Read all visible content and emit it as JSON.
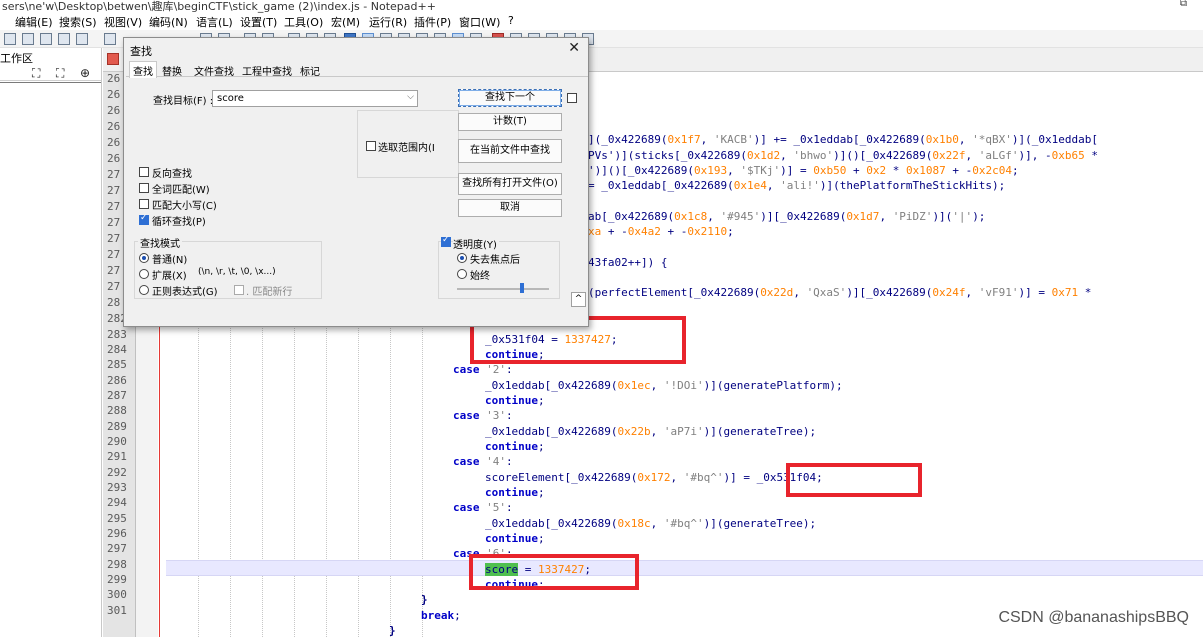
{
  "window": {
    "title": "sers\\ne'w\\Desktop\\betwen\\趣库\\beginCTF\\stick_game (2)\\index.js - Notepad++",
    "restore_glyph": "⧉"
  },
  "menu": [
    "编辑(E)",
    "搜索(S)",
    "视图(V)",
    "编码(N)",
    "语言(L)",
    "设置(T)",
    "工具(O)",
    "宏(M)",
    "运行(R)",
    "插件(P)",
    "窗口(W)",
    "?"
  ],
  "workspace": {
    "title": "工作区",
    "icons": [
      "sync-icon",
      "sync-scroll-icon",
      "locate-icon"
    ]
  },
  "editor": {
    "line_numbers_top": [
      "26",
      "26",
      "26",
      "26",
      "26",
      "26",
      "27",
      "27",
      "27",
      "27",
      "27",
      "27",
      "27",
      "27",
      "28"
    ],
    "line_numbers": [
      "282",
      "283",
      "284",
      "285",
      "286",
      "287",
      "288",
      "289",
      "290",
      "291",
      "292",
      "293",
      "294",
      "295",
      "296",
      "297",
      "298",
      "299",
      "300",
      "301"
    ],
    "right_code": [
      {
        "t1": "](_0x422689(",
        "h1": "0x1f7",
        "t2": ", ",
        "s1": "'KACB'",
        "t3": ")] += _0x1eddab[_0x422689(",
        "h2": "0x1b0",
        "t4": ", ",
        "s2": "'*qBX'",
        "t5": ")](_0x1eddab["
      },
      {
        "t1": "PVs')](sticks[_0x422689(",
        "h1": "0x1d2",
        "t2": ", ",
        "s1": "'bhwo'",
        "t3": ")]()[_0x422689(",
        "h2": "0x22f",
        "t4": ", ",
        "s2": "'aLGf'",
        "t5": ")], -",
        "h3": "0xb65",
        "t6": " *"
      },
      {
        "t1": "')]()[_0x422689(",
        "h1": "0x193",
        "t2": ", ",
        "s1": "'$TKj'",
        "t3": ")] = ",
        "h2": "0xb50",
        "t4": " + ",
        "h3": "0x2",
        "t5": " * ",
        "h4": "0x1087",
        "t6": " + -",
        "h5": "0x2c04",
        "t7": ";"
      },
      {
        "t1": "= _0x1eddab[_0x422689(",
        "h1": "0x1e4",
        "t2": ", ",
        "s1": "'ali!'",
        "t3": ")](thePlatformTheStickHits);"
      },
      {
        "t1": "ab[_0x422689(",
        "h1": "0x1c8",
        "t2": ", ",
        "s1": "'#945'",
        "t3": ")][_0x422689(",
        "h2": "0x1d7",
        "t4": ", ",
        "s2": "'PiDZ'",
        "t5": ")](",
        "s3": "'|'",
        "t6": ");"
      },
      {
        "h1": "xa",
        "t1": " + -",
        "h2": "0x4a2",
        "t2": " + -",
        "h3": "0x2110",
        "t3": ";"
      },
      {
        "t1": "43fa02++]) {"
      },
      {
        "t1": "(perfectElement[_0x422689(",
        "h1": "0x22d",
        "t2": ", ",
        "s1": "'QxaS'",
        "t3": ")][_0x422689(",
        "h2": "0x24f",
        "t4": ", ",
        "s2": "'vF91'",
        "t5": ")] = ",
        "h3": "0x71",
        "t6": " *"
      }
    ],
    "lines": {
      "l282_var": "_0x531f04",
      "l282_eq": " = ",
      "l282_num": "1337427",
      "semicolon": ";",
      "continue": "continue",
      "case": "case",
      "l283_case2": "'2'",
      "colon": ":",
      "l285_a": "_0x1eddab[_0x422689(",
      "l285_h": "0x1ec",
      "l285_b": ", ",
      "l285_s": "'!DOi'",
      "l285_c": ")](generatePlatform);",
      "l287_s": "'3'",
      "l288_a": "_0x1eddab[_0x422689(",
      "l288_h": "0x22b",
      "l288_b": ", ",
      "l288_s": "'aP7i'",
      "l288_c": ")](generateTree);",
      "l290_s": "'4'",
      "l291_a": "scoreElement[_0x422689(",
      "l291_h": "0x172",
      "l291_b": ", ",
      "l291_s": "'#bq^'",
      "l291_c": ")] ",
      "l291_d": "= _0x531f04;",
      "l293_s": "'5'",
      "l294_a": "_0x1eddab[_0x422689(",
      "l294_h": "0x18c",
      "l294_b": ", ",
      "l294_s": "'#bq^'",
      "l294_c": ")](generateTree);",
      "l296_s": "'6'",
      "l297_score": "score",
      "l297_eq": " = ",
      "l297_num": "1337427",
      "close_brace": "}",
      "break": "break"
    }
  },
  "find_dialog": {
    "title": "查找",
    "close": "✕",
    "tabs": [
      "查找",
      "替换",
      "文件查找",
      "工程中查找",
      "标记"
    ],
    "active_tab": "查找",
    "find_label": "查找目标(F) :",
    "find_value": "score",
    "buttons": {
      "find_next": "查找下一个",
      "count": "计数(T)",
      "find_in_current": "在当前文件中查找",
      "find_in_all_open": "查找所有打开文件(O)",
      "cancel": "取消"
    },
    "in_selection": "选取范围内(I",
    "options": {
      "backward": "反向查找",
      "whole_word": "全词匹配(W)",
      "match_case": "匹配大小写(C)",
      "wrap_around": "循环查找(P)"
    },
    "mode_group": "查找模式",
    "modes": {
      "normal": "普通(N)",
      "extended": "扩展(X)",
      "extended_hint": "(\\n, \\r, \\t, \\0, \\x...)",
      "regex": "正则表达式(G)",
      "dot_newline": ". 匹配新行"
    },
    "transparency": {
      "label": "透明度(Y)",
      "on_lose_focus": "失去焦点后",
      "always": "始终",
      "level": 0.65
    },
    "collapse_glyph": "^"
  },
  "watermark": "CSDN @bananashipsBBQ",
  "colors": {
    "keyword": "#0000c8",
    "identifier": "#000080",
    "hex_number": "#ff8000",
    "string": "#808080",
    "highlight": "#4fbf4f",
    "annotation_box": "#e8242c"
  }
}
